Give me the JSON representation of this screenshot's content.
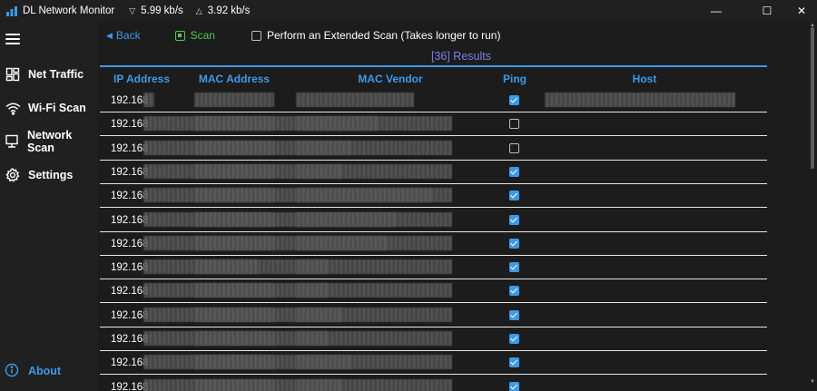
{
  "titlebar": {
    "app_title": "DL Network Monitor",
    "download_speed": "5.99 kb/s",
    "upload_speed": "3.92 kb/s",
    "download_arrow": "▽",
    "upload_arrow": "△"
  },
  "window_controls": {
    "minimize": "—",
    "maximize": "☐",
    "close": "✕"
  },
  "sidebar": {
    "items": [
      {
        "label": "Net Traffic",
        "icon": "dashboard-icon"
      },
      {
        "label": "Wi-Fi Scan",
        "icon": "wifi-icon"
      },
      {
        "label": "Network Scan",
        "icon": "monitor-icon"
      },
      {
        "label": "Settings",
        "icon": "gear-icon"
      }
    ],
    "about_label": "About"
  },
  "toolbar": {
    "back_label": "Back",
    "scan_label": "Scan",
    "extended_scan_label": "Perform an Extended Scan (Takes longer to run)",
    "extended_scan_checked": false
  },
  "results": {
    "label": "[36] Results"
  },
  "table": {
    "columns": [
      "IP Address",
      "MAC Address",
      "MAC Vendor",
      "Ping",
      "Host"
    ],
    "rows": [
      {
        "ip": "192.168",
        "ping": true
      },
      {
        "ip": "192.168",
        "ping": false
      },
      {
        "ip": "192.168",
        "ping": false
      },
      {
        "ip": "192.168",
        "ping": true
      },
      {
        "ip": "192.168",
        "ping": true
      },
      {
        "ip": "192.168",
        "ping": true
      },
      {
        "ip": "192.168",
        "ping": true
      },
      {
        "ip": "192.168",
        "ping": true
      },
      {
        "ip": "192.168",
        "ping": true
      },
      {
        "ip": "192.168",
        "ping": true
      },
      {
        "ip": "192.168",
        "ping": true
      },
      {
        "ip": "192.168",
        "ping": true
      },
      {
        "ip": "192.168",
        "ping": true
      }
    ]
  },
  "colors": {
    "accent": "#3d9ae8",
    "scan_green": "#4ec94e",
    "results_purple": "#7d7de8",
    "background": "#1c1c1c"
  }
}
